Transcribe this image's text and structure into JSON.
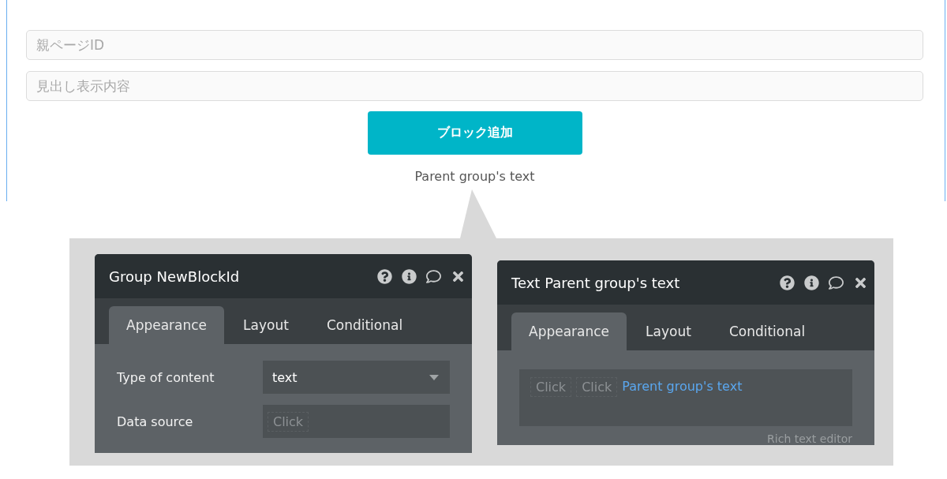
{
  "form": {
    "fields": [
      {
        "placeholder": "親ページID"
      },
      {
        "placeholder": "見出し表示内容"
      }
    ],
    "button": "ブロック追加",
    "caption": "Parent group's text"
  },
  "inspectors": [
    {
      "kind": "properties",
      "title": "Group NewBlockId",
      "tabs": [
        {
          "label": "Appearance",
          "selected": true
        },
        {
          "label": "Layout",
          "selected": false
        },
        {
          "label": "Conditional",
          "selected": false
        }
      ],
      "rows": [
        {
          "label": "Type of content",
          "kind": "dropdown",
          "value": "text"
        },
        {
          "label": "Data source",
          "kind": "dynamic",
          "value": "Click"
        }
      ]
    },
    {
      "kind": "rich_text",
      "title": "Text Parent group's text",
      "tabs": [
        {
          "label": "Appearance",
          "selected": true
        },
        {
          "label": "Layout",
          "selected": false
        },
        {
          "label": "Conditional",
          "selected": false
        }
      ],
      "tokens": [
        {
          "kind": "click",
          "text": "Click"
        },
        {
          "kind": "click",
          "text": "Click"
        },
        {
          "kind": "expression",
          "text": "Parent group's text"
        }
      ],
      "footer": "Rich text editor"
    }
  ]
}
